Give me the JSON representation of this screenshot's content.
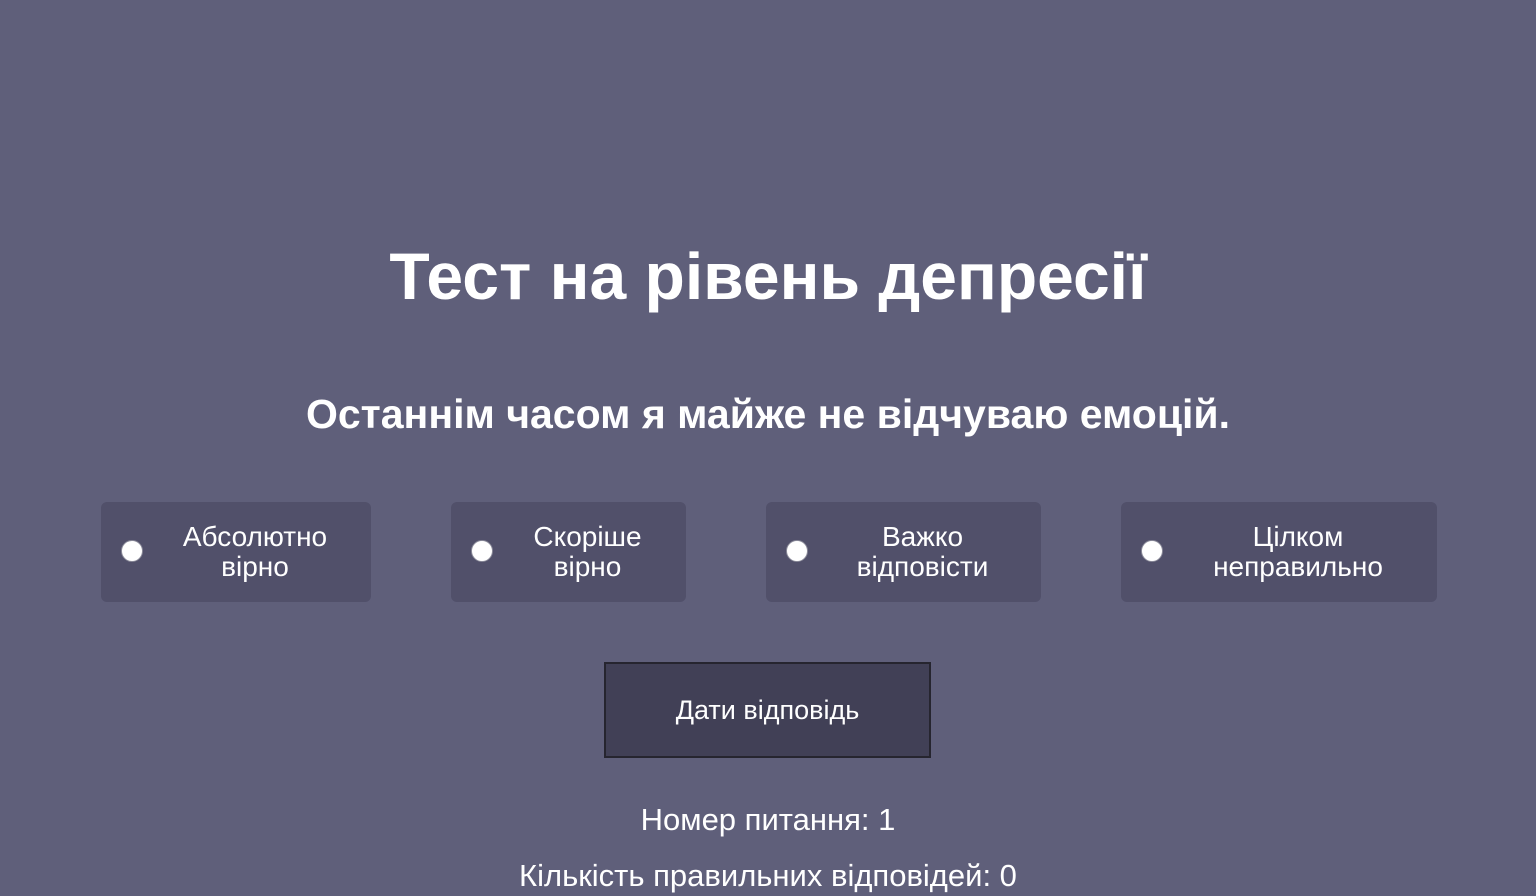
{
  "title": "Тест на рівень депресії",
  "question": "Останнім часом я майже не відчуваю емоцій.",
  "options": [
    {
      "line1": "Абсолютно",
      "line2": "вірно"
    },
    {
      "line1": "Скоріше",
      "line2": "вірно"
    },
    {
      "line1": "Важко",
      "line2": "відповісти"
    },
    {
      "line1": "Цілком",
      "line2": "неправильно"
    }
  ],
  "submit_label": "Дати відповідь",
  "question_number": "Номер питання: 1",
  "correct_count": "Кількість правильних відповідей: 0",
  "colors": {
    "background": "#5f5f7a",
    "option_bg": "#51506a",
    "button_bg": "#414056",
    "text": "#ffffff"
  }
}
